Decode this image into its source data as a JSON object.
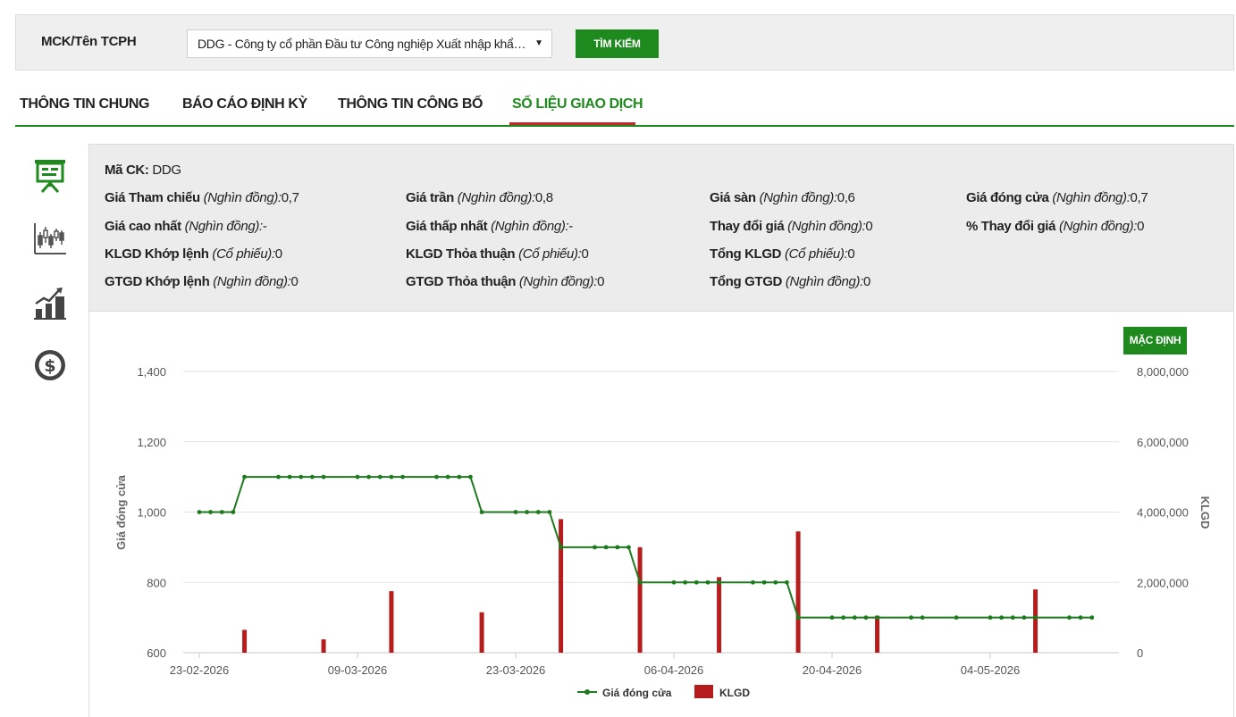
{
  "search": {
    "label": "MCK/Tên TCPH",
    "selected_company": "DDG - Công ty cổ phần Đầu tư Công nghiệp Xuất nhập khẩu Đông Dương",
    "button_label": "TÌM KIẾM"
  },
  "tabs": [
    {
      "label": "THÔNG TIN CHUNG",
      "active": false
    },
    {
      "label": "BÁO CÁO ĐỊNH KỲ",
      "active": false
    },
    {
      "label": "THÔNG TIN CÔNG BỐ",
      "active": false
    },
    {
      "label": "SỐ LIỆU GIAO DỊCH",
      "active": true
    }
  ],
  "side_icons": [
    "presentation-board-icon",
    "candlestick-chart-icon",
    "bar-chart-icon",
    "dollar-coin-icon"
  ],
  "info": {
    "symbol": {
      "label": "Mã CK:",
      "value": "DDG"
    },
    "rows": [
      [
        {
          "label": "Giá Tham chiếu",
          "unit": "(Nghìn đồng):",
          "value": "0,7"
        },
        {
          "label": "Giá trần",
          "unit": "(Nghìn đồng):",
          "value": "0,8"
        },
        {
          "label": "Giá sàn",
          "unit": "(Nghìn đồng):",
          "value": "0,6"
        },
        {
          "label": "Giá đóng cửa",
          "unit": "(Nghìn đồng):",
          "value": "0,7"
        }
      ],
      [
        {
          "label": "Giá cao nhất",
          "unit": "(Nghìn đồng):",
          "value": "-"
        },
        {
          "label": "Giá thấp nhất",
          "unit": "(Nghìn đồng):",
          "value": "-"
        },
        {
          "label": "Thay đổi giá",
          "unit": "(Nghìn đồng):",
          "value": "0"
        },
        {
          "label": "% Thay đổi giá",
          "unit": "(Nghìn đồng):",
          "value": "0"
        }
      ],
      [
        {
          "label": "KLGD Khớp lệnh",
          "unit": "(Cổ phiếu):",
          "value": "0"
        },
        {
          "label": "KLGD Thỏa thuận",
          "unit": "(Cổ phiếu):",
          "value": "0"
        },
        {
          "label": "Tổng KLGD",
          "unit": "(Cổ phiếu):",
          "value": "0"
        }
      ],
      [
        {
          "label": "GTGD Khớp lệnh",
          "unit": "(Nghìn đồng):",
          "value": "0"
        },
        {
          "label": "GTGD Thỏa thuận",
          "unit": "(Nghìn đồng):",
          "value": "0"
        },
        {
          "label": "Tổng GTGD",
          "unit": "(Nghìn đồng):",
          "value": "0"
        }
      ]
    ]
  },
  "chart_controls": {
    "default_button": "MẶC ĐỊNH"
  },
  "colors": {
    "accent_green": "#1e8a1e",
    "tab_underline_red": "#c62828",
    "volume_bar": "#b71c1c",
    "price_line": "#1e7a1e"
  },
  "chart_data": {
    "type": "line+bar",
    "x_start": "2026-02-23",
    "x_end": "2026-05-13",
    "xticks": [
      "23-02-2026",
      "09-03-2026",
      "23-03-2026",
      "06-04-2026",
      "20-04-2026",
      "04-05-2026"
    ],
    "y_left": {
      "label": "Giá đóng cửa",
      "lim": [
        600,
        1400
      ],
      "ticks": [
        "600",
        "800",
        "1,000",
        "1,200",
        "1,400"
      ]
    },
    "y_right": {
      "label": "KLGD",
      "lim": [
        0,
        8000000
      ],
      "ticks": [
        "0",
        "2,000,000",
        "4,000,000",
        "6,000,000",
        "8,000,000"
      ]
    },
    "legend": [
      "Giá đóng cửa",
      "KLGD"
    ],
    "legend_position": "bottom",
    "grid": true,
    "price_series": {
      "name": "Giá đóng cửa",
      "points": [
        [
          "2026-02-23",
          1000
        ],
        [
          "2026-02-24",
          1000
        ],
        [
          "2026-02-25",
          1000
        ],
        [
          "2026-02-26",
          1000
        ],
        [
          "2026-02-27",
          1100
        ],
        [
          "2026-03-02",
          1100
        ],
        [
          "2026-03-03",
          1100
        ],
        [
          "2026-03-04",
          1100
        ],
        [
          "2026-03-05",
          1100
        ],
        [
          "2026-03-06",
          1100
        ],
        [
          "2026-03-09",
          1100
        ],
        [
          "2026-03-10",
          1100
        ],
        [
          "2026-03-11",
          1100
        ],
        [
          "2026-03-12",
          1100
        ],
        [
          "2026-03-13",
          1100
        ],
        [
          "2026-03-16",
          1100
        ],
        [
          "2026-03-17",
          1100
        ],
        [
          "2026-03-18",
          1100
        ],
        [
          "2026-03-19",
          1100
        ],
        [
          "2026-03-20",
          1000
        ],
        [
          "2026-03-23",
          1000
        ],
        [
          "2026-03-24",
          1000
        ],
        [
          "2026-03-25",
          1000
        ],
        [
          "2026-03-26",
          1000
        ],
        [
          "2026-03-27",
          900
        ],
        [
          "2026-03-30",
          900
        ],
        [
          "2026-03-31",
          900
        ],
        [
          "2026-04-01",
          900
        ],
        [
          "2026-04-02",
          900
        ],
        [
          "2026-04-03",
          800
        ],
        [
          "2026-04-06",
          800
        ],
        [
          "2026-04-07",
          800
        ],
        [
          "2026-04-08",
          800
        ],
        [
          "2026-04-09",
          800
        ],
        [
          "2026-04-10",
          800
        ],
        [
          "2026-04-13",
          800
        ],
        [
          "2026-04-14",
          800
        ],
        [
          "2026-04-15",
          800
        ],
        [
          "2026-04-16",
          800
        ],
        [
          "2026-04-17",
          700
        ],
        [
          "2026-04-20",
          700
        ],
        [
          "2026-04-21",
          700
        ],
        [
          "2026-04-22",
          700
        ],
        [
          "2026-04-23",
          700
        ],
        [
          "2026-04-24",
          700
        ],
        [
          "2026-04-27",
          700
        ],
        [
          "2026-04-28",
          700
        ],
        [
          "2026-05-01",
          700
        ],
        [
          "2026-05-04",
          700
        ],
        [
          "2026-05-05",
          700
        ],
        [
          "2026-05-06",
          700
        ],
        [
          "2026-05-07",
          700
        ],
        [
          "2026-05-08",
          700
        ],
        [
          "2026-05-11",
          700
        ],
        [
          "2026-05-12",
          700
        ],
        [
          "2026-05-13",
          700
        ]
      ]
    },
    "volume_series": {
      "name": "KLGD",
      "points": [
        [
          "2026-02-27",
          650000
        ],
        [
          "2026-03-06",
          380000
        ],
        [
          "2026-03-12",
          1750000
        ],
        [
          "2026-03-20",
          1150000
        ],
        [
          "2026-03-27",
          3800000
        ],
        [
          "2026-04-03",
          3000000
        ],
        [
          "2026-04-10",
          2150000
        ],
        [
          "2026-04-17",
          3450000
        ],
        [
          "2026-04-24",
          1050000
        ],
        [
          "2026-05-08",
          1800000
        ]
      ]
    }
  }
}
